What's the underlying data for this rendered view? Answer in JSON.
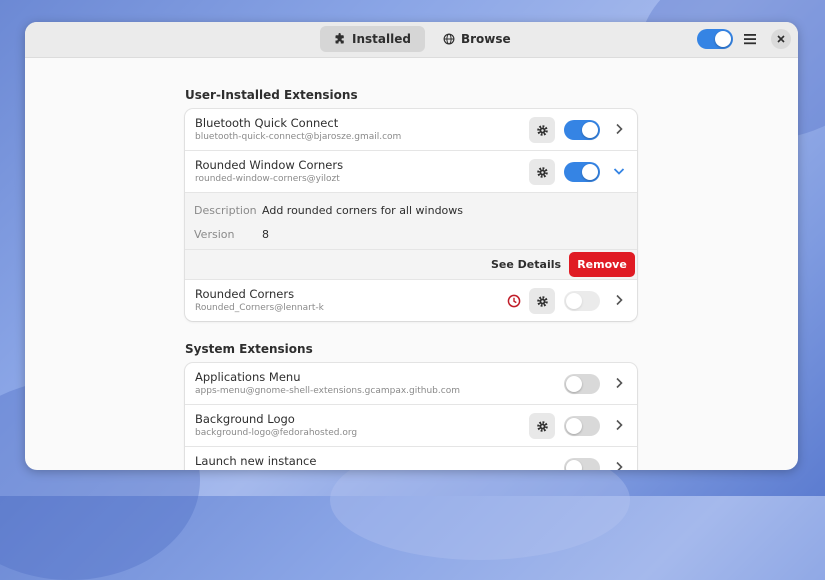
{
  "header": {
    "tabs": [
      {
        "label": "Installed",
        "icon": "puzzle-icon",
        "active": true
      },
      {
        "label": "Browse",
        "icon": "globe-icon",
        "active": false
      }
    ],
    "extensions_enabled": true
  },
  "user_section": {
    "title": "User-Installed Extensions",
    "items": [
      {
        "name": "Bluetooth Quick Connect",
        "uuid": "bluetooth-quick-connect@bjarosze.gmail.com",
        "enabled": true,
        "has_settings": true,
        "expanded": false
      },
      {
        "name": "Rounded Window Corners",
        "uuid": "rounded-window-corners@yilozt",
        "enabled": true,
        "has_settings": true,
        "expanded": true
      },
      {
        "name": "Rounded Corners",
        "uuid": "Rounded_Corners@lennart-k",
        "enabled": false,
        "has_settings": true,
        "error": true,
        "expanded": false
      }
    ],
    "expanded_details": {
      "description_label": "Description",
      "description_value": "Add rounded corners for all windows",
      "version_label": "Version",
      "version_value": "8",
      "see_details_label": "See Details",
      "remove_label": "Remove"
    }
  },
  "system_section": {
    "title": "System Extensions",
    "items": [
      {
        "name": "Applications Menu",
        "uuid": "apps-menu@gnome-shell-extensions.gcampax.github.com",
        "enabled": false,
        "has_settings": false
      },
      {
        "name": "Background Logo",
        "uuid": "background-logo@fedorahosted.org",
        "enabled": false,
        "has_settings": true
      },
      {
        "name": "Launch new instance",
        "uuid": "",
        "enabled": false,
        "has_settings": false
      }
    ]
  },
  "colors": {
    "accent": "#3584e4",
    "destructive": "#e01b24",
    "error_icon": "#c01c28"
  }
}
